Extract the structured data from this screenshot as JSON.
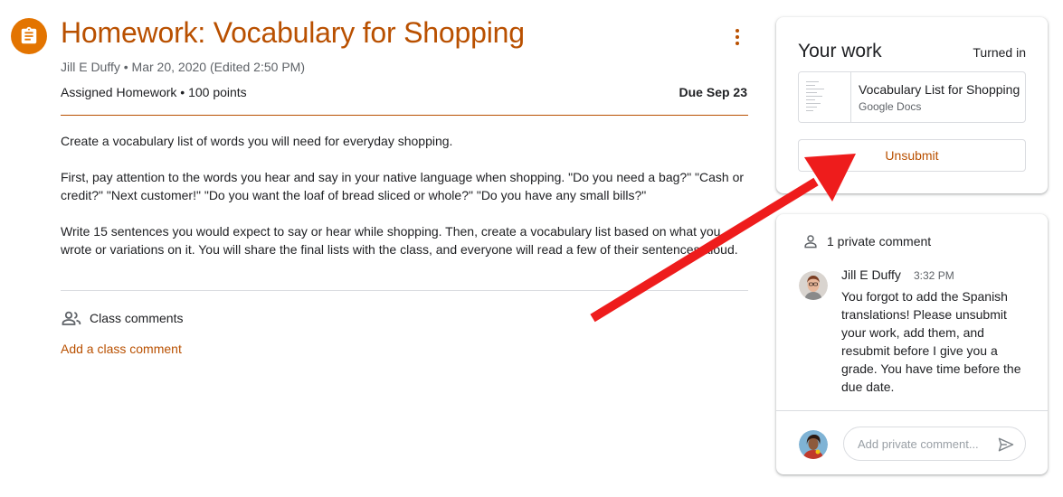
{
  "assignment": {
    "title": "Homework: Vocabulary for Shopping",
    "meta": "Jill E Duffy • Mar 20, 2020 (Edited 2:50 PM)",
    "points": "Assigned Homework • 100 points",
    "due": "Due Sep 23",
    "description": [
      "Create a vocabulary list of words you will need for everyday shopping.",
      "First, pay attention to the words you hear and say in your native language when shopping. \"Do you need a bag?\" \"Cash or credit?\" \"Next customer!\" \"Do you want the loaf of bread sliced or whole?\" \"Do you have any small bills?\"",
      "Write 15 sentences you would expect to say or hear while shopping. Then, create a vocabulary list based on what you wrote or variations on it. You will share the final lists with the class, and everyone will read a few of their sentences aloud."
    ]
  },
  "class_comments": {
    "label": "Class comments",
    "add_label": "Add a class comment"
  },
  "your_work": {
    "title": "Your work",
    "status": "Turned in",
    "attachment": {
      "name": "Vocabulary List for Shopping",
      "type": "Google Docs"
    },
    "unsubmit_label": "Unsubmit"
  },
  "private_comments": {
    "header": "1 private comment",
    "comment": {
      "author": "Jill E Duffy",
      "time": "3:32 PM",
      "text": "You forgot to add the Spanish translations! Please unsubmit your work, add them, and resubmit before I give you a grade. You have time before the due date."
    },
    "input_placeholder": "Add private comment..."
  },
  "colors": {
    "accent": "#b95000",
    "icon_bg": "#e37400",
    "annotation_arrow": "#ee1c1c"
  },
  "icons": {
    "assignment": "assignment-icon",
    "more": "more-vert-icon",
    "class_comments": "people-icon",
    "private_comment": "person-icon",
    "send": "send-icon"
  }
}
